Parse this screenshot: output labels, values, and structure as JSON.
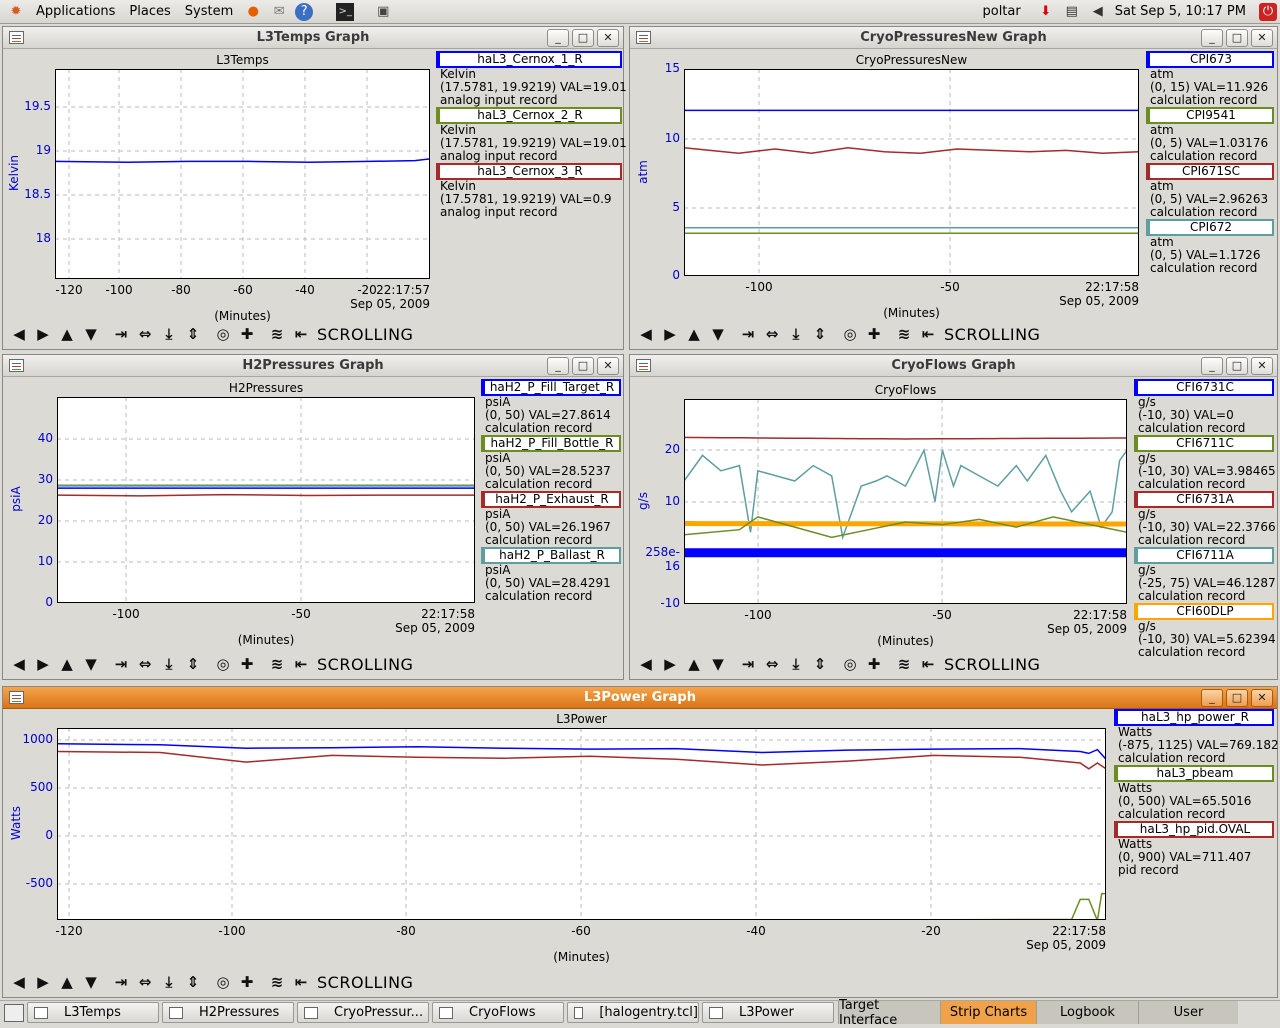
{
  "topbar": {
    "menus": [
      "Applications",
      "Places",
      "System"
    ],
    "user": "poltar",
    "clock": "Sat Sep  5, 10:17 PM",
    "launchers": [
      "firefox-icon",
      "mail-icon",
      "help-icon",
      "terminal-icon",
      "camera-icon"
    ]
  },
  "windows": [
    {
      "id": "l3temps",
      "title": "L3Temps Graph",
      "active": false,
      "plot_title": "L3Temps",
      "ylabel": "Kelvin",
      "timestamp": [
        "22:17:57",
        "Sep 05, 2009"
      ],
      "xlabel": "(Minutes)",
      "mode": "SCROLLING",
      "xticks": [
        "-120",
        "-100",
        "-80",
        "-60",
        "-40",
        "-20"
      ],
      "yticks": [
        "19.5",
        "19",
        "18.5",
        "18"
      ],
      "legend": [
        {
          "name": "haL3_Cernox_1_R",
          "color": "#0000ff",
          "lines": [
            "Kelvin",
            "(17.5781, 19.9219) VAL=19.01",
            "analog input record"
          ]
        },
        {
          "name": "haL3_Cernox_2_R",
          "color": "#6b8e23",
          "lines": [
            "Kelvin",
            "(17.5781, 19.9219) VAL=19.01",
            "analog input record"
          ]
        },
        {
          "name": "haL3_Cernox_3_R",
          "color": "#a52a2a",
          "lines": [
            "Kelvin",
            "(17.5781, 19.9219) VAL=0.9",
            "analog input record"
          ]
        }
      ],
      "chart_data": {
        "type": "line",
        "xlim": [
          -124,
          0
        ],
        "ylim": [
          17.6,
          20.1
        ],
        "series": [
          {
            "name": "haL3_Cernox_1_R",
            "color": "#0000ff",
            "x": [
              -124,
              -100,
              -80,
              -60,
              -40,
              -20,
              -5,
              0
            ],
            "y": [
              19.0,
              18.99,
              19.0,
              19.0,
              18.99,
              19.0,
              19.01,
              19.03
            ]
          }
        ]
      }
    },
    {
      "id": "cryopressures",
      "title": "CryoPressuresNew Graph",
      "active": false,
      "plot_title": "CryoPressuresNew",
      "ylabel": "atm",
      "timestamp": [
        "22:17:58",
        "Sep 05, 2009"
      ],
      "xlabel": "(Minutes)",
      "mode": "SCROLLING",
      "xticks": [
        "-100",
        "-50"
      ],
      "yticks": [
        "15",
        "10",
        "5",
        "0"
      ],
      "legend": [
        {
          "name": "CPI673",
          "color": "#0000ff",
          "lines": [
            "atm",
            "(0, 15) VAL=11.926",
            "calculation record"
          ]
        },
        {
          "name": "CPI9541",
          "color": "#6b8e23",
          "lines": [
            "atm",
            "(0, 5) VAL=1.03176",
            "calculation record"
          ]
        },
        {
          "name": "CPI671SC",
          "color": "#a52a2a",
          "lines": [
            "atm",
            "(0, 5) VAL=2.96263",
            "calculation record"
          ]
        },
        {
          "name": "CPI672",
          "color": "#5f9ea0",
          "lines": [
            "atm",
            "(0, 5) VAL=1.1726",
            "calculation record"
          ]
        }
      ],
      "chart_data": {
        "type": "line",
        "xlim": [
          -125,
          0
        ],
        "ylim": [
          0,
          15
        ],
        "series": [
          {
            "name": "CPI673",
            "color": "#0000ff",
            "x": [
              -125,
              0
            ],
            "y": [
              12.0,
              12.0
            ]
          },
          {
            "name": "CPI671SC",
            "color": "#a52a2a",
            "x": [
              -125,
              -110,
              -100,
              -90,
              -80,
              -70,
              -60,
              -50,
              -40,
              -30,
              -20,
              -10,
              0
            ],
            "y": [
              9.3,
              8.9,
              9.2,
              8.9,
              9.3,
              9.0,
              8.9,
              9.2,
              9.1,
              9.0,
              9.1,
              8.9,
              9.0
            ]
          },
          {
            "name": "CPI672",
            "color": "#5f9ea0",
            "x": [
              -125,
              0
            ],
            "y": [
              3.5,
              3.5
            ]
          },
          {
            "name": "CPI9541",
            "color": "#6b8e23",
            "x": [
              -125,
              0
            ],
            "y": [
              3.1,
              3.1
            ]
          }
        ]
      }
    },
    {
      "id": "h2pressures",
      "title": "H2Pressures Graph",
      "active": false,
      "plot_title": "H2Pressures",
      "ylabel": "psiA",
      "timestamp": [
        "22:17:58",
        "Sep 05, 2009"
      ],
      "xlabel": "(Minutes)",
      "mode": "SCROLLING",
      "xticks": [
        "-100",
        "-50"
      ],
      "yticks": [
        "40",
        "30",
        "20",
        "10",
        "0"
      ],
      "legend": [
        {
          "name": "haH2_P_Fill_Target_R",
          "color": "#0000ff",
          "lines": [
            "psiA",
            "(0, 50) VAL=27.8614",
            "calculation record"
          ]
        },
        {
          "name": "haH2_P_Fill_Bottle_R",
          "color": "#6b8e23",
          "lines": [
            "psiA",
            "(0, 50) VAL=28.5237",
            "calculation record"
          ]
        },
        {
          "name": "haH2_P_Exhaust_R",
          "color": "#a52a2a",
          "lines": [
            "psiA",
            "(0, 50) VAL=26.1967",
            "calculation record"
          ]
        },
        {
          "name": "haH2_P_Ballast_R",
          "color": "#5f9ea0",
          "lines": [
            "psiA",
            "(0, 50) VAL=28.4291",
            "calculation record"
          ]
        }
      ],
      "chart_data": {
        "type": "line",
        "xlim": [
          -125,
          0
        ],
        "ylim": [
          0,
          50
        ],
        "series": [
          {
            "name": "haH2_P_Fill_Bottle_R",
            "color": "#6b8e23",
            "x": [
              -125,
              0
            ],
            "y": [
              28.6,
              28.6
            ]
          },
          {
            "name": "haH2_P_Ballast_R",
            "color": "#5f9ea0",
            "x": [
              -125,
              0
            ],
            "y": [
              28.4,
              28.4
            ]
          },
          {
            "name": "haH2_P_Fill_Target_R",
            "color": "#0000ff",
            "x": [
              -125,
              0
            ],
            "y": [
              27.9,
              27.9
            ]
          },
          {
            "name": "haH2_P_Exhaust_R",
            "color": "#a52a2a",
            "x": [
              -125,
              -100,
              -75,
              -50,
              -25,
              0
            ],
            "y": [
              26.2,
              26.0,
              26.3,
              26.1,
              26.2,
              26.2
            ]
          }
        ]
      }
    },
    {
      "id": "cryoflows",
      "title": "CryoFlows Graph",
      "active": false,
      "plot_title": "CryoFlows",
      "ylabel": "g/s",
      "timestamp": [
        "22:17:58",
        "Sep 05, 2009"
      ],
      "xlabel": "(Minutes)",
      "mode": "SCROLLING",
      "xticks": [
        "-100",
        "-50"
      ],
      "yticks": [
        "20",
        "10",
        "258e-16",
        "-10"
      ],
      "legend": [
        {
          "name": "CFI6731C",
          "color": "#0000ff",
          "lines": [
            "g/s",
            "(-10, 30) VAL=0",
            "calculation record"
          ]
        },
        {
          "name": "CFI6711C",
          "color": "#6b8e23",
          "lines": [
            "g/s",
            "(-10, 30) VAL=3.98465",
            "calculation record"
          ]
        },
        {
          "name": "CFI6731A",
          "color": "#a52a2a",
          "lines": [
            "g/s",
            "(-10, 30) VAL=22.3766",
            "calculation record"
          ]
        },
        {
          "name": "CFI6711A",
          "color": "#5f9ea0",
          "lines": [
            "g/s",
            "(-25, 75) VAL=46.1287",
            "calculation record"
          ]
        },
        {
          "name": "CFI60DLP",
          "color": "#ffa500",
          "lines": [
            "g/s",
            "(-10, 30) VAL=5.62394",
            "calculation record"
          ]
        }
      ],
      "chart_data": {
        "type": "line",
        "xlim": [
          -120,
          0
        ],
        "ylim": [
          -10,
          30
        ],
        "series": [
          {
            "name": "CFI6731A",
            "color": "#a52a2a",
            "x": [
              -120,
              -60,
              0
            ],
            "y": [
              22.5,
              22.2,
              22.4
            ]
          },
          {
            "name": "CFI6711A",
            "color": "#5f9ea0",
            "x": [
              -120,
              -115,
              -110,
              -105,
              -102,
              -100,
              -95,
              -90,
              -85,
              -80,
              -77,
              -72,
              -68,
              -65,
              -60,
              -55,
              -52,
              -50,
              -47,
              -45,
              -40,
              -35,
              -30,
              -27,
              -22,
              -18,
              -15,
              -10,
              -7,
              -4,
              -2,
              0
            ],
            "y": [
              14,
              19,
              16,
              17,
              4,
              16,
              15,
              14,
              17,
              15,
              3,
              13,
              14,
              15,
              13,
              20,
              10,
              20,
              13,
              17,
              15,
              13,
              17,
              14,
              19,
              12,
              8,
              12,
              5,
              8,
              18,
              20
            ]
          },
          {
            "name": "CFI60DLP",
            "color": "#ffa500",
            "x": [
              -120,
              0
            ],
            "y": [
              5.7,
              5.6
            ]
          },
          {
            "name": "CFI6711C",
            "color": "#6b8e23",
            "x": [
              -120,
              -105,
              -100,
              -90,
              -80,
              -70,
              -60,
              -50,
              -40,
              -30,
              -20,
              -10,
              0
            ],
            "y": [
              3.5,
              4.5,
              7.0,
              5.0,
              3.0,
              4.5,
              6.0,
              5.5,
              6.5,
              5.0,
              7.0,
              5.5,
              4.0
            ]
          },
          {
            "name": "CFI6731C",
            "color": "#0000ff",
            "x": [
              -120,
              0
            ],
            "y": [
              0,
              0
            ]
          }
        ]
      }
    },
    {
      "id": "l3power",
      "title": "L3Power Graph",
      "active": true,
      "plot_title": "L3Power",
      "ylabel": "Watts",
      "timestamp": [
        "22:17:58",
        "Sep 05, 2009"
      ],
      "xlabel": "(Minutes)",
      "mode": "SCROLLING",
      "xticks": [
        "-120",
        "-100",
        "-80",
        "-60",
        "-40",
        "-20"
      ],
      "yticks": [
        "1000",
        "500",
        "0",
        "-500"
      ],
      "legend": [
        {
          "name": "haL3_hp_power_R",
          "color": "#0000ff",
          "lines": [
            "Watts",
            "(-875, 1125) VAL=769.182",
            "calculation record"
          ]
        },
        {
          "name": "haL3_pbeam",
          "color": "#6b8e23",
          "lines": [
            "Watts",
            "(0, 500) VAL=65.5016",
            "calculation record"
          ]
        },
        {
          "name": "haL3_hp_pid.OVAL",
          "color": "#a52a2a",
          "lines": [
            "Watts",
            "(0, 900) VAL=711.407",
            "pid record"
          ]
        }
      ],
      "chart_data": {
        "type": "line",
        "xlim": [
          -122,
          0
        ],
        "ylim": [
          -875,
          1125
        ],
        "series": [
          {
            "name": "haL3_hp_power_R",
            "color": "#0000ff",
            "x": [
              -122,
              -110,
              -100,
              -90,
              -80,
              -70,
              -60,
              -50,
              -40,
              -30,
              -20,
              -10,
              -3,
              -2,
              -1,
              0
            ],
            "y": [
              960,
              950,
              915,
              920,
              930,
              915,
              905,
              910,
              870,
              895,
              905,
              910,
              880,
              860,
              900,
              800
            ]
          },
          {
            "name": "haL3_hp_pid.OVAL",
            "color": "#a52a2a",
            "x": [
              -122,
              -110,
              -100,
              -90,
              -80,
              -70,
              -60,
              -50,
              -40,
              -30,
              -20,
              -10,
              -3,
              -2,
              -1,
              0
            ],
            "y": [
              880,
              870,
              770,
              840,
              820,
              810,
              830,
              800,
              740,
              780,
              840,
              820,
              760,
              700,
              760,
              700
            ]
          },
          {
            "name": "haL3_pbeam",
            "color": "#6b8e23",
            "x": [
              -122,
              -40,
              -10,
              -4,
              -3,
              -2,
              -1,
              -0.5,
              0
            ],
            "y": [
              -880,
              -880,
              -870,
              -870,
              -660,
              -660,
              -880,
              -600,
              -600
            ]
          }
        ]
      }
    }
  ],
  "taskbar": {
    "tasks": [
      "L3Temps",
      "H2Pressures",
      "CryoPressur...",
      "CryoFlows",
      "[halogentry.tcl]",
      "L3Power"
    ],
    "tabs": [
      "Target Interface",
      "Strip Charts",
      "Logbook",
      "User"
    ],
    "active_tab": "Strip Charts"
  }
}
